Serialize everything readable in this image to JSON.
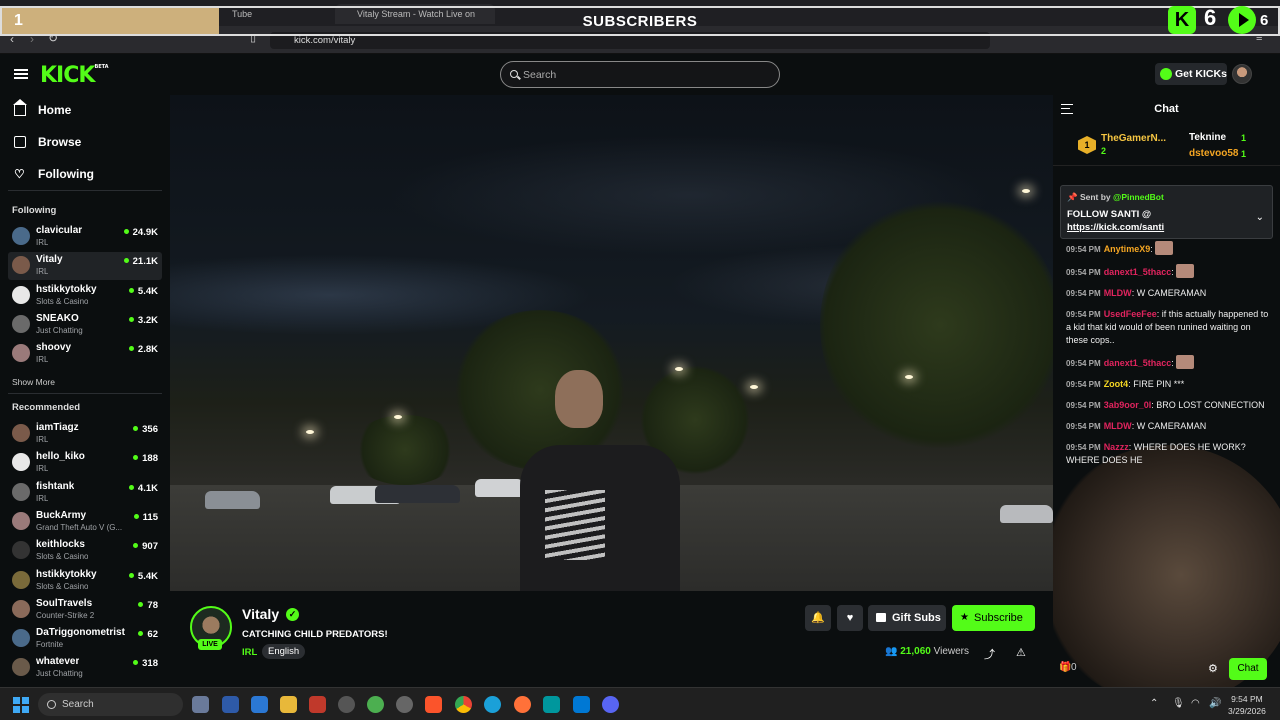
{
  "browser": {
    "tabs": [
      {
        "label": "Tube"
      },
      {
        "label": "Vitaly Stream - Watch Live on"
      }
    ],
    "url": "kick.com/vitaly"
  },
  "overlay": {
    "sub_count": "1",
    "title": "SUBSCRIBERS",
    "kick_count": "6",
    "play_count": "6",
    "progress_fraction": 0.17
  },
  "header": {
    "logo": "KICK",
    "logo_badge": "BETA",
    "search_placeholder": "Search",
    "get_kicks": "Get KICKs"
  },
  "sidebar": {
    "nav": [
      {
        "label": "Home",
        "icon": "home-icon"
      },
      {
        "label": "Browse",
        "icon": "browse-icon"
      },
      {
        "label": "Following",
        "icon": "heart-icon"
      }
    ],
    "following_title": "Following",
    "following": [
      {
        "name": "clavicular",
        "category": "IRL",
        "viewers": "24.9K"
      },
      {
        "name": "Vitaly",
        "category": "IRL",
        "viewers": "21.1K"
      },
      {
        "name": "hstikkytokky",
        "category": "Slots & Casino",
        "viewers": "5.4K"
      },
      {
        "name": "SNEAKO",
        "category": "Just Chatting",
        "viewers": "3.2K"
      },
      {
        "name": "shoovy",
        "category": "IRL",
        "viewers": "2.8K"
      }
    ],
    "show_more": "Show More",
    "recommended_title": "Recommended",
    "recommended": [
      {
        "name": "iamTiagz",
        "category": "IRL",
        "viewers": "356"
      },
      {
        "name": "hello_kiko",
        "category": "IRL",
        "viewers": "188"
      },
      {
        "name": "fishtank",
        "category": "IRL",
        "viewers": "4.1K"
      },
      {
        "name": "BuckArmy",
        "category": "Grand Theft Auto V (G...",
        "viewers": "115"
      },
      {
        "name": "keithlocks",
        "category": "Slots & Casino",
        "viewers": "907"
      },
      {
        "name": "hstikkytokky",
        "category": "Slots & Casino",
        "viewers": "5.4K"
      },
      {
        "name": "SoulTravels",
        "category": "Counter-Strike 2",
        "viewers": "78"
      },
      {
        "name": "DaTriggonometrist",
        "category": "Fortnite",
        "viewers": "62"
      },
      {
        "name": "whatever",
        "category": "Just Chatting",
        "viewers": "318"
      }
    ]
  },
  "stream": {
    "streamer": "Vitaly",
    "live": "LIVE",
    "title": "CATCHING CHILD PREDATORS!",
    "category": "IRL",
    "language": "English",
    "gift_subs": "Gift Subs",
    "subscribe": "Subscribe",
    "viewer_count": "21,060",
    "viewers_label": "Viewers"
  },
  "chat": {
    "title": "Chat",
    "leaderboard": [
      {
        "rank": "1",
        "name": "TheGamerN...",
        "count": "2"
      },
      {
        "name": "Teknine",
        "count": "1"
      },
      {
        "name": "dstevoo58",
        "count": "1"
      }
    ],
    "pinned": {
      "sent_by": "Sent by",
      "bot": "@PinnedBot",
      "message": "FOLLOW SANTI @",
      "link": "https://kick.com/santi"
    },
    "messages": [
      {
        "time": "09:54 PM",
        "user": "AnytimeX9",
        "color": "#f5a623",
        "text": "",
        "emote": true
      },
      {
        "time": "09:54 PM",
        "user": "danext1_5thacc",
        "color": "#e0245e",
        "text": "",
        "emote": true
      },
      {
        "time": "09:54 PM",
        "user": "MLDW",
        "color": "#e0245e",
        "text": "W CAMERAMAN"
      },
      {
        "time": "09:54 PM",
        "user": "UsedFeeFee",
        "color": "#e0245e",
        "text": "if this actually happened to a kid that kid would of been runined waiting on these cops.."
      },
      {
        "time": "09:54 PM",
        "user": "danext1_5thacc",
        "color": "#e0245e",
        "text": "",
        "emote": true
      },
      {
        "time": "09:54 PM",
        "user": "Zoot4",
        "color": "#f5d623",
        "text": "FIRE PIN ***"
      },
      {
        "time": "09:54 PM",
        "user": "3ab9oor_0l",
        "color": "#e0245e",
        "text": "BRO LOST CONNECTION"
      },
      {
        "time": "09:54 PM",
        "user": "MLDW",
        "color": "#e0245e",
        "text": "W CAMERAMAN"
      },
      {
        "time": "09:54 PM",
        "user": "Nazzz",
        "color": "#e0245e",
        "text": "WHERE DOES HE WORK? WHERE DOES HE"
      }
    ],
    "gift_count": "0",
    "chat_button": "Chat"
  },
  "taskbar": {
    "search": "Search",
    "time": "9:54 PM",
    "date": "3/29/2026"
  },
  "colors": {
    "kick_green": "#53fc18",
    "background": "#0b0e0f"
  }
}
